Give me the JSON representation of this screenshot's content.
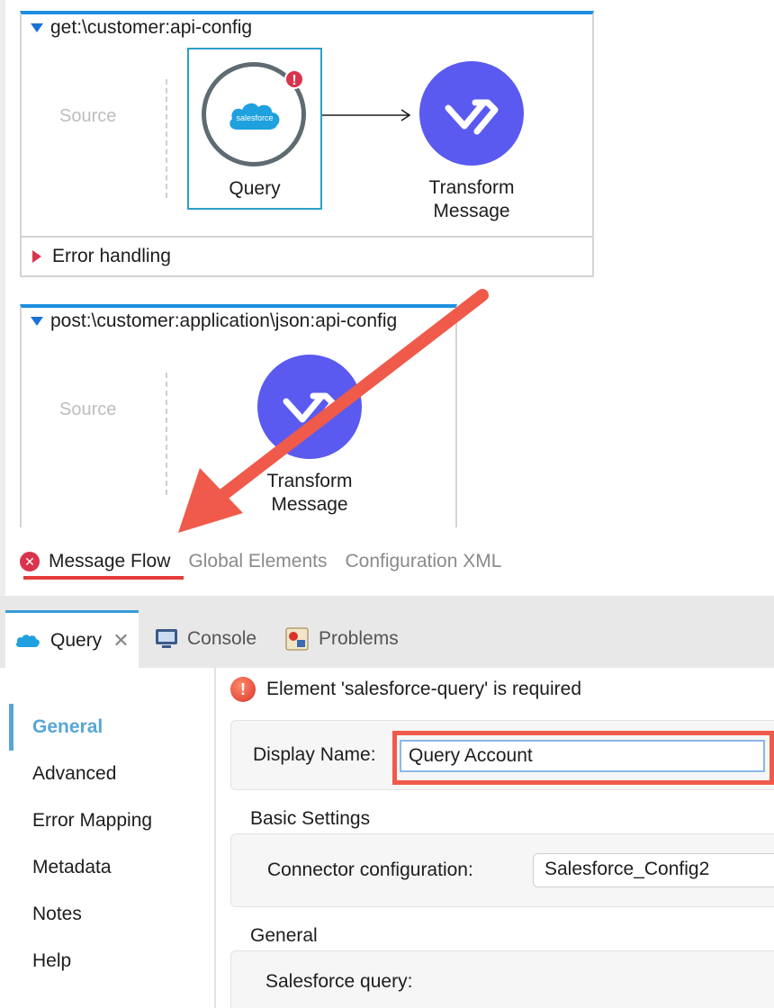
{
  "flow1": {
    "title": "get:\\customer:api-config",
    "source_label": "Source",
    "components": [
      {
        "label_line1": "Query",
        "icon": "salesforce-icon",
        "has_error": true,
        "error_glyph": "!"
      },
      {
        "label_line1": "Transform",
        "label_line2": "Message",
        "icon": "dataweave-icon"
      }
    ],
    "error_handling_label": "Error handling",
    "cloud_text": "salesforce"
  },
  "flow2": {
    "title": "post:\\customer:application\\json:api-config",
    "source_label": "Source",
    "component": {
      "label_line1": "Transform",
      "label_line2": "Message",
      "icon": "dataweave-icon"
    }
  },
  "editor_tabs": [
    {
      "label": "Message Flow",
      "active": true,
      "has_error": true
    },
    {
      "label": "Global Elements",
      "active": false
    },
    {
      "label": "Configuration XML",
      "active": false
    }
  ],
  "panel_tabs": [
    {
      "label": "Query",
      "active": true,
      "closable": true,
      "icon": "salesforce-icon"
    },
    {
      "label": "Console",
      "active": false,
      "icon": "console-icon"
    },
    {
      "label": "Problems",
      "active": false,
      "icon": "problems-icon"
    }
  ],
  "side_nav": [
    {
      "label": "General",
      "active": true
    },
    {
      "label": "Advanced"
    },
    {
      "label": "Error Mapping"
    },
    {
      "label": "Metadata"
    },
    {
      "label": "Notes"
    },
    {
      "label": "Help"
    }
  ],
  "properties": {
    "error_message": "Element 'salesforce-query' is required",
    "error_glyph": "!",
    "display_name_label": "Display Name:",
    "display_name_value": "Query Account",
    "basic_settings_label": "Basic Settings",
    "connector_config_label": "Connector configuration:",
    "connector_config_value": "Salesforce_Config2",
    "general_label": "General",
    "salesforce_query_label": "Salesforce query:"
  },
  "colors": {
    "flow_header": "#1d8fe0",
    "transform": "#5a5af0",
    "error": "#d8344c",
    "annotation": "#f05a4a",
    "nav_active": "#58a6d6"
  }
}
